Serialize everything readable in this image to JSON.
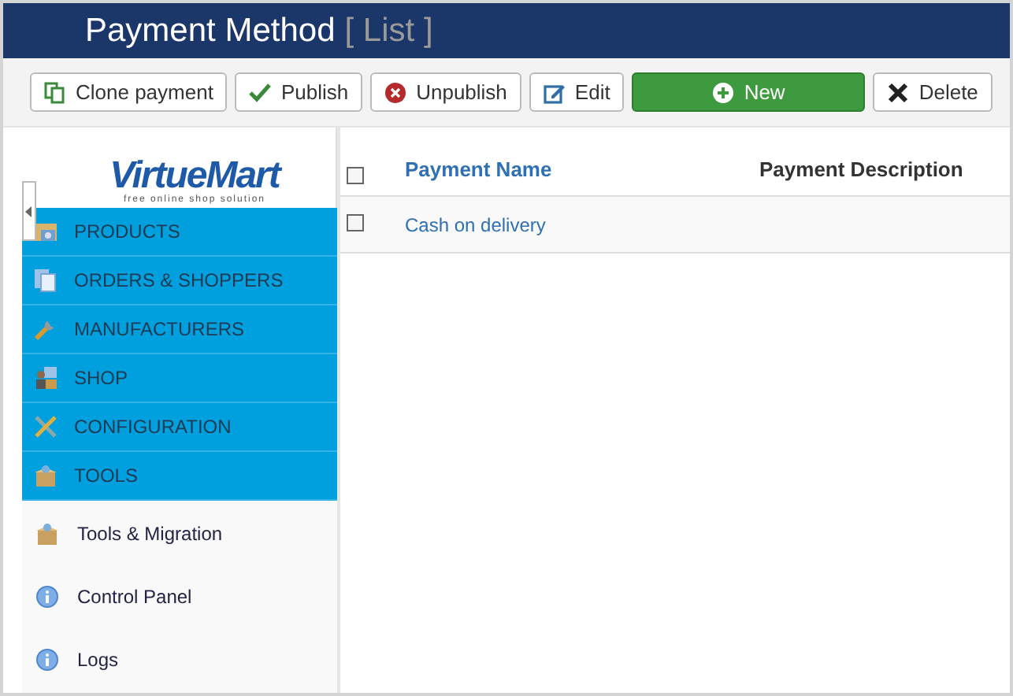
{
  "header": {
    "title": "Payment Method",
    "subtitle": "[ List ]"
  },
  "toolbar": [
    {
      "kind": "clone",
      "label": "Clone payment"
    },
    {
      "kind": "publish",
      "label": "Publish"
    },
    {
      "kind": "unpublish",
      "label": "Unpublish"
    },
    {
      "kind": "edit",
      "label": "Edit"
    },
    {
      "kind": "new",
      "label": "New"
    },
    {
      "kind": "delete",
      "label": "Delete"
    }
  ],
  "sidebar": {
    "logo": {
      "name": "VirtueMart",
      "tagline": "free online shop solution"
    },
    "menu": [
      {
        "kind": "products",
        "label": "PRODUCTS"
      },
      {
        "kind": "orders",
        "label": "ORDERS & SHOPPERS"
      },
      {
        "kind": "manufacturers",
        "label": "MANUFACTURERS"
      },
      {
        "kind": "shop",
        "label": "SHOP"
      },
      {
        "kind": "configuration",
        "label": "CONFIGURATION"
      },
      {
        "kind": "tools",
        "label": "TOOLS"
      }
    ],
    "submenu": [
      {
        "kind": "tools",
        "label": "Tools & Migration"
      },
      {
        "kind": "info",
        "label": "Control Panel"
      },
      {
        "kind": "info",
        "label": "Logs"
      }
    ]
  },
  "table": {
    "columns": [
      "Payment Name",
      "Payment Description"
    ],
    "header_checked": false,
    "rows": [
      {
        "name": "Cash on delivery",
        "checked": false
      }
    ]
  }
}
